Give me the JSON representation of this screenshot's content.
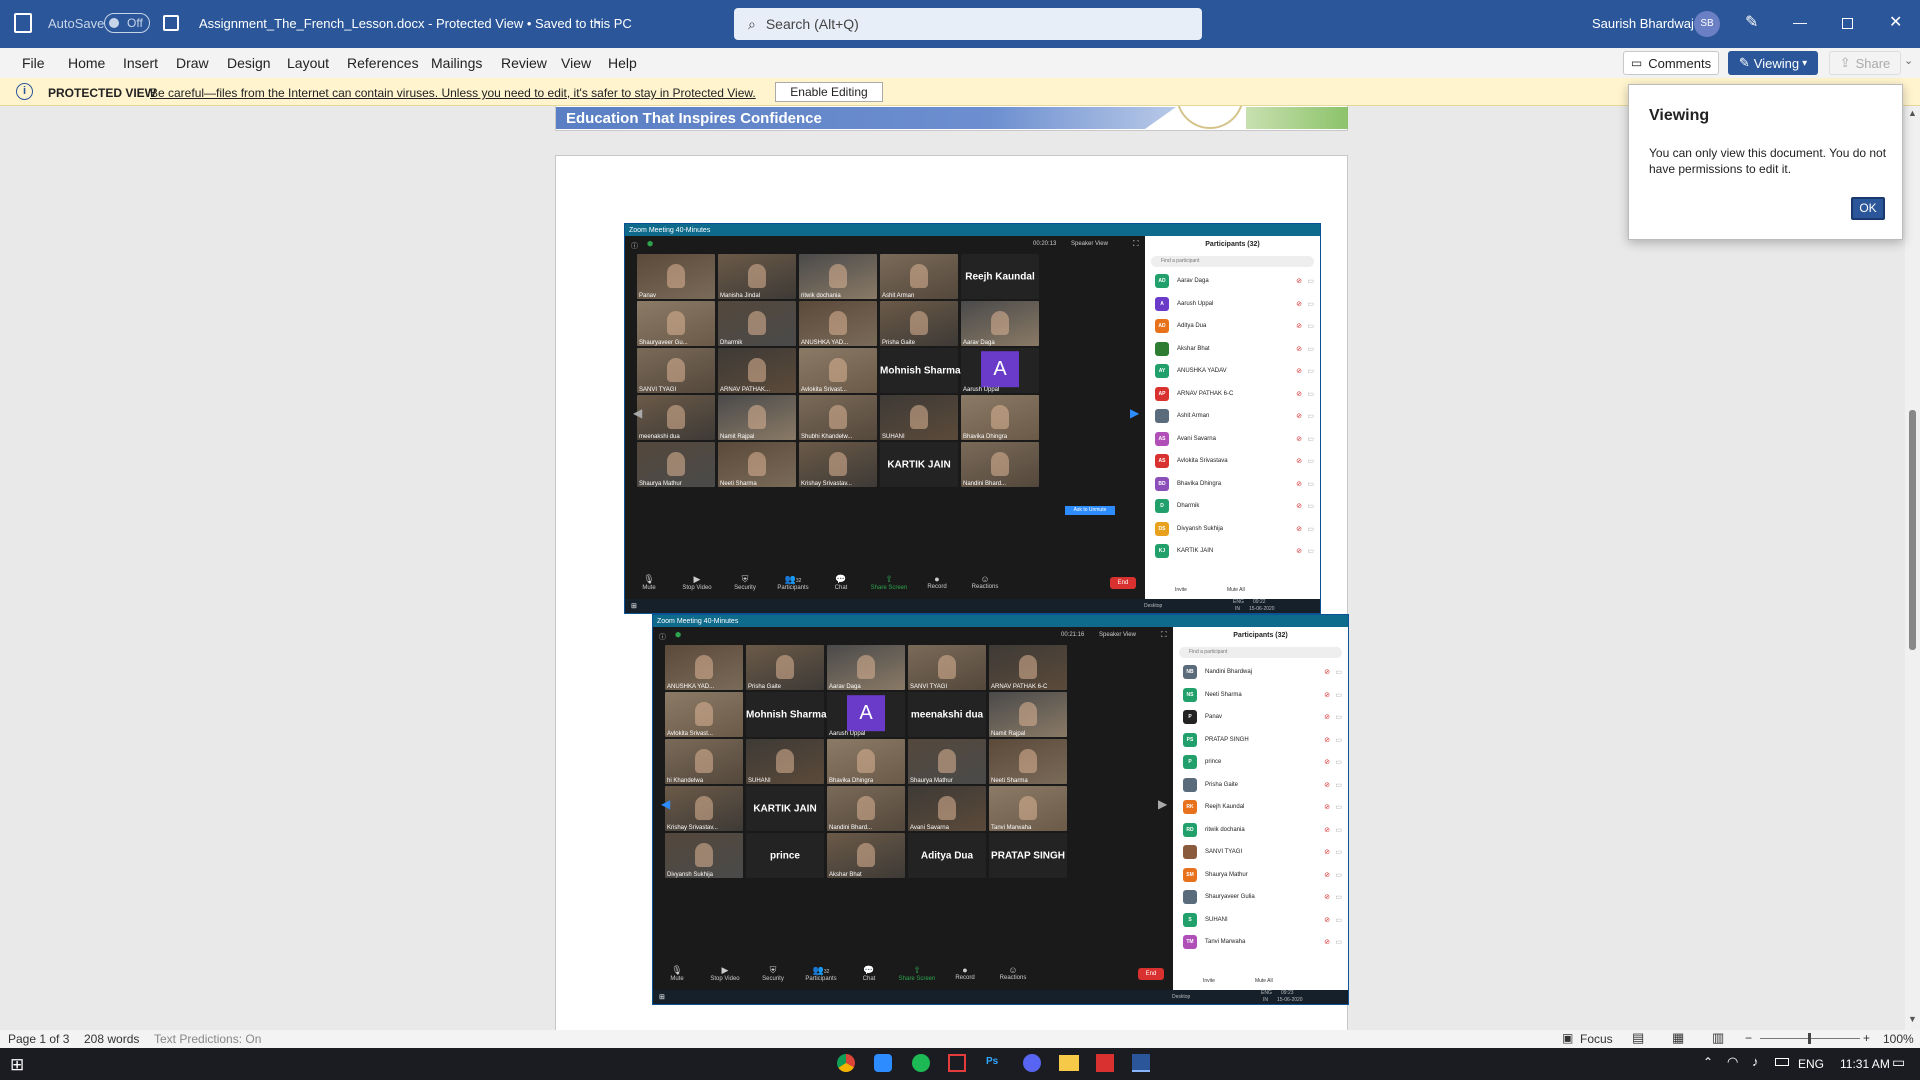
{
  "titlebar": {
    "autosave_label": "AutoSave",
    "autosave_state": "Off",
    "doc_title": "Assignment_The_French_Lesson.docx  -  Protected View • Saved to this PC",
    "search_placeholder": "Search (Alt+Q)",
    "user_name": "Saurish Bhardwaj",
    "user_initials": "SB"
  },
  "ribbon": {
    "tabs": [
      "File",
      "Home",
      "Insert",
      "Draw",
      "Design",
      "Layout",
      "References",
      "Mailings",
      "Review",
      "View",
      "Help"
    ],
    "comments_label": "Comments",
    "viewing_label": "Viewing",
    "share_label": "Share"
  },
  "protected_view": {
    "label": "PROTECTED VIEW",
    "message": "Be careful—files from the Internet can contain viruses. Unless you need to edit, it's safer to stay in Protected View.",
    "enable_label": "Enable Editing"
  },
  "document": {
    "banner_text": "Education That Inspires Confidence"
  },
  "viewing_popup": {
    "title": "Viewing",
    "body": "You can only view this document. You do not have permissions to edit it.",
    "ok_label": "OK"
  },
  "zoom1": {
    "window_title": "Zoom Meeting 40-Minutes",
    "timer": "00:20:13",
    "speaker_view": "Speaker View",
    "participants_header": "Participants (32)",
    "find_placeholder": "Find a participant",
    "tiles": [
      {
        "name": "Panav",
        "big": ""
      },
      {
        "name": "Manisha Jindal",
        "big": ""
      },
      {
        "name": "ritwik dochania",
        "big": ""
      },
      {
        "name": "Ashit Arman",
        "big": ""
      },
      {
        "name": "",
        "big": "Reejh  Kaundal"
      },
      {
        "name": "Shauryaveer Gu...",
        "big": ""
      },
      {
        "name": "Dharmik",
        "big": ""
      },
      {
        "name": "ANUSHKA YAD...",
        "big": ""
      },
      {
        "name": "Prisha Gaite",
        "big": ""
      },
      {
        "name": "Aarav  Daga",
        "big": ""
      },
      {
        "name": "SANVI TYAGI",
        "big": ""
      },
      {
        "name": "ARNAV PATHAK...",
        "big": ""
      },
      {
        "name": "Avlokita Srivast...",
        "big": ""
      },
      {
        "name": "",
        "big": "Mohnish Sharma"
      },
      {
        "name": "Aarush Uppal",
        "big": "",
        "avatar": "A"
      },
      {
        "name": "meenakshi  dua",
        "big": ""
      },
      {
        "name": "Namit Rajpal",
        "big": ""
      },
      {
        "name": "Shubhi Khandelw...",
        "big": ""
      },
      {
        "name": "SUHANI",
        "big": ""
      },
      {
        "name": "Bhavika Dhingra",
        "big": ""
      },
      {
        "name": "Shaurya Mathur",
        "big": ""
      },
      {
        "name": "Neeti Sharma",
        "big": ""
      },
      {
        "name": "Krishay Srivastav...",
        "big": ""
      },
      {
        "name": "",
        "big": "KARTIK JAIN"
      },
      {
        "name": "Nandini Bhard...",
        "big": ""
      }
    ],
    "ask_unmute": "Ask to Unmute",
    "participants": [
      {
        "initials": "AD",
        "name": "Aarav  Daga",
        "color": "#22a06b"
      },
      {
        "initials": "A",
        "name": "Aarush Uppal",
        "color": "#6a3bc9"
      },
      {
        "initials": "AD",
        "name": "Aditya Dua",
        "color": "#e8711c"
      },
      {
        "initials": "",
        "name": "Akshar Bhat",
        "color": "#2e7d32"
      },
      {
        "initials": "AY",
        "name": "ANUSHKA YADAV",
        "color": "#22a06b"
      },
      {
        "initials": "AP",
        "name": "ARNAV PATHAK 6-C",
        "color": "#d9312f"
      },
      {
        "initials": "",
        "name": "Ashit Arman",
        "color": "#5a6b7c"
      },
      {
        "initials": "AS",
        "name": "Avani  Savarna",
        "color": "#b04fb8"
      },
      {
        "initials": "AS",
        "name": "Avlokita Srivastava",
        "color": "#d9312f"
      },
      {
        "initials": "BD",
        "name": "Bhavika Dhingra",
        "color": "#8a4fb8"
      },
      {
        "initials": "D",
        "name": "Dharmik",
        "color": "#22a06b"
      },
      {
        "initials": "DS",
        "name": "Divyansh Sukhija",
        "color": "#e8a11c"
      },
      {
        "initials": "KJ",
        "name": "KARTIK JAIN",
        "color": "#22a06b"
      }
    ],
    "invite": "Invite",
    "mute_all": "Mute All",
    "controls": [
      "Mute",
      "Stop Video",
      "Security",
      "Participants",
      "Chat",
      "Share Screen",
      "Record",
      "Reactions"
    ],
    "participant_count": "32",
    "end_label": "End",
    "task_desktop": "Desktop",
    "task_lang": "ENG",
    "task_region": "IN",
    "task_time": "09:22",
    "task_date": "15-06-2020"
  },
  "zoom2": {
    "window_title": "Zoom Meeting 40-Minutes",
    "timer": "00:21:16",
    "speaker_view": "Speaker View",
    "participants_header": "Participants (32)",
    "find_placeholder": "Find a participant",
    "tiles": [
      {
        "name": "ANUSHKA YAD...",
        "big": ""
      },
      {
        "name": "Prisha Gaite",
        "big": ""
      },
      {
        "name": "Aarav  Daga",
        "big": ""
      },
      {
        "name": "SANVI TYAGI",
        "big": ""
      },
      {
        "name": "ARNAV PATHAK 6-C",
        "big": ""
      },
      {
        "name": "Avlokita Srivast...",
        "big": ""
      },
      {
        "name": "",
        "big": "Mohnish Sharma"
      },
      {
        "name": "Aarush Uppal",
        "big": "",
        "avatar": "A"
      },
      {
        "name": "",
        "big": "meenakshi  dua"
      },
      {
        "name": "Namit Rajpal",
        "big": ""
      },
      {
        "name": "hi Khandelwa",
        "big": ""
      },
      {
        "name": "SUHANI",
        "big": ""
      },
      {
        "name": "Bhavika Dhingra",
        "big": ""
      },
      {
        "name": "Shaurya Mathur",
        "big": ""
      },
      {
        "name": "Neeti Sharma",
        "big": ""
      },
      {
        "name": "Krishay Srivastav...",
        "big": ""
      },
      {
        "name": "",
        "big": "KARTIK JAIN"
      },
      {
        "name": "Nandini Bhard...",
        "big": ""
      },
      {
        "name": "Avani  Savarna",
        "big": ""
      },
      {
        "name": "Tanvi Marwaha",
        "big": ""
      },
      {
        "name": "Divyansh Sukhija",
        "big": ""
      },
      {
        "name": "",
        "big": "prince"
      },
      {
        "name": "Akshar Bhat",
        "big": ""
      },
      {
        "name": "",
        "big": "Aditya Dua"
      },
      {
        "name": "",
        "big": "PRATAP SINGH"
      }
    ],
    "participants": [
      {
        "initials": "NB",
        "name": "Nandini Bhardwaj",
        "color": "#5a6b7c"
      },
      {
        "initials": "NS",
        "name": "Neeti Sharma",
        "color": "#22a06b"
      },
      {
        "initials": "P",
        "name": "Panav",
        "color": "#222222"
      },
      {
        "initials": "PS",
        "name": "PRATAP SINGH",
        "color": "#22a06b"
      },
      {
        "initials": "P",
        "name": "prince",
        "color": "#22a06b"
      },
      {
        "initials": "",
        "name": "Prisha Gaite",
        "color": "#5a6b7c"
      },
      {
        "initials": "RK",
        "name": "Reejh  Kaundal",
        "color": "#e8711c"
      },
      {
        "initials": "RD",
        "name": "ritwik dochania",
        "color": "#22a06b"
      },
      {
        "initials": "",
        "name": "SANVI TYAGI",
        "color": "#8a5a3c"
      },
      {
        "initials": "SM",
        "name": "Shaurya Mathur",
        "color": "#e8711c"
      },
      {
        "initials": "",
        "name": "Shauryaveer Gulia",
        "color": "#5a6b7c"
      },
      {
        "initials": "S",
        "name": "SUHANI",
        "color": "#22a06b"
      },
      {
        "initials": "TM",
        "name": "Tanvi Marwaha",
        "color": "#b04fb8"
      }
    ],
    "invite": "Invite",
    "mute_all": "Mute All",
    "controls": [
      "Mute",
      "Stop Video",
      "Security",
      "Participants",
      "Chat",
      "Share Screen",
      "Record",
      "Reactions"
    ],
    "participant_count": "32",
    "end_label": "End",
    "task_desktop": "Desktop",
    "task_lang": "ENG",
    "task_region": "IN",
    "task_time": "09:23",
    "task_date": "15-06-2020"
  },
  "statusbar": {
    "page": "Page 1 of 3",
    "words": "208 words",
    "predictions": "Text Predictions: On",
    "focus": "Focus",
    "zoom_minus": "−",
    "zoom_plus": "+",
    "zoom_pct": "100%"
  },
  "taskbar": {
    "lang": "ENG",
    "time": "11:31 AM"
  },
  "colors": {
    "word_blue": "#2b579a",
    "warning_yellow": "#fff4ce",
    "zoom_dark": "#1a1a1a"
  }
}
